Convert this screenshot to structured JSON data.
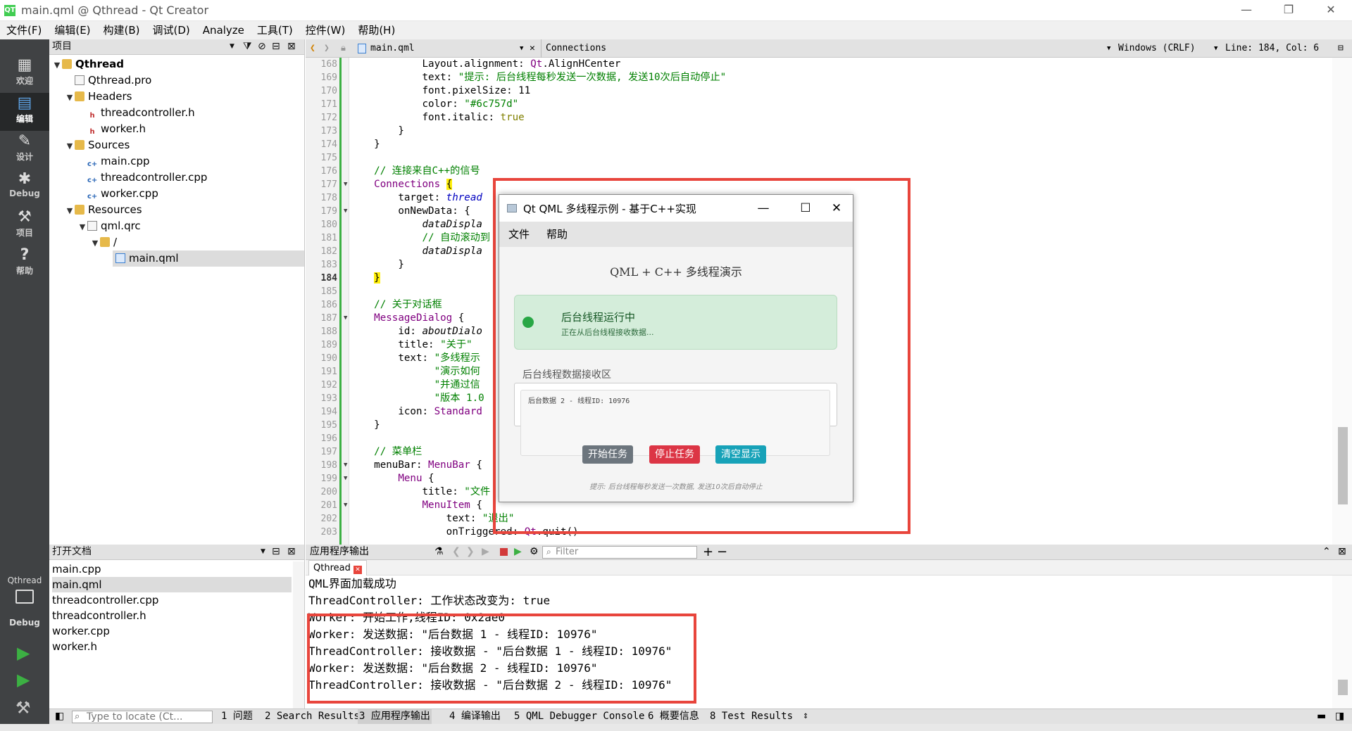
{
  "window": {
    "title": "main.qml @ Qthread - Qt Creator",
    "logo": "QT"
  },
  "menu": [
    "文件(F)",
    "编辑(E)",
    "构建(B)",
    "调试(D)",
    "Analyze",
    "工具(T)",
    "控件(W)",
    "帮助(H)"
  ],
  "modes": [
    {
      "label": "欢迎",
      "icon": "grid-icon"
    },
    {
      "label": "编辑",
      "icon": "document-icon"
    },
    {
      "label": "设计",
      "icon": "pencil-icon"
    },
    {
      "label": "Debug",
      "icon": "bug-icon"
    },
    {
      "label": "项目",
      "icon": "wrench-icon"
    },
    {
      "label": "帮助",
      "icon": "help-icon"
    }
  ],
  "kit": {
    "project": "Qthread",
    "mode": "Debug"
  },
  "project_panel": {
    "title": "项目",
    "tree": [
      {
        "label": "Qthread",
        "bold": true
      },
      {
        "label": "Qthread.pro"
      },
      {
        "label": "Headers"
      },
      {
        "label": "threadcontroller.h"
      },
      {
        "label": "worker.h"
      },
      {
        "label": "Sources"
      },
      {
        "label": "main.cpp"
      },
      {
        "label": "threadcontroller.cpp"
      },
      {
        "label": "worker.cpp"
      },
      {
        "label": "Resources"
      },
      {
        "label": "qml.qrc"
      },
      {
        "label": "/"
      },
      {
        "label": "main.qml",
        "selected": true
      }
    ]
  },
  "open_docs": {
    "title": "打开文档",
    "items": [
      "main.cpp",
      "main.qml",
      "threadcontroller.cpp",
      "threadcontroller.h",
      "worker.cpp",
      "worker.h"
    ]
  },
  "editor": {
    "file": "main.qml",
    "symbol": "Connections",
    "line_ending": "Windows (CRLF)",
    "position": "Line: 184, Col: 6",
    "line_numbers": [
      "168",
      "169",
      "170",
      "171",
      "172",
      "173",
      "174",
      "175",
      "176",
      "177",
      "178",
      "179",
      "180",
      "181",
      "182",
      "183",
      "184",
      "185",
      "186",
      "187",
      "188",
      "189",
      "190",
      "191",
      "192",
      "193",
      "194",
      "195",
      "196",
      "197",
      "198",
      "199",
      "200",
      "201",
      "202",
      "203"
    ],
    "code": [
      "            Layout.alignment: Qt.AlignHCenter",
      "            text: \"提示: 后台线程每秒发送一次数据, 发送10次后自动停止\"",
      "            font.pixelSize: 11",
      "            color: \"#6c757d\"",
      "            font.italic: true",
      "        }",
      "    }",
      "",
      "    // 连接来自C++的信号",
      "    Connections {",
      "        target: thread",
      "        onNewData: {",
      "            dataDispla",
      "            // 自动滚动到",
      "            dataDispla",
      "        }",
      "    }",
      "",
      "    // 关于对话框",
      "    MessageDialog {",
      "        id: aboutDialo",
      "        title: \"关于\"",
      "        text: \"多线程示",
      "              \"演示如何",
      "              \"并通过信",
      "              \"版本 1.0",
      "        icon: Standard",
      "    }",
      "",
      "    // 菜单栏",
      "    menuBar: MenuBar {",
      "        Menu {",
      "            title: \"文件",
      "            MenuItem {",
      "                text: \"退出\"",
      "                onTriggered: Qt.quit()"
    ]
  },
  "app_window": {
    "title": "Qt QML 多线程示例 - 基于C++实现",
    "menu": [
      "文件",
      "帮助"
    ],
    "heading": "QML + C++ 多线程演示",
    "status_title": "后台线程运行中",
    "status_sub": "正在从后台线程接收数据...",
    "receive_label": "后台线程数据接收区",
    "data_line": "后台数据 2 - 线程ID: 10976",
    "buttons": {
      "start": "开始任务",
      "stop": "停止任务",
      "clear": "清空显示"
    },
    "hint": "提示: 后台线程每秒发送一次数据, 发送10次后自动停止",
    "colors": {
      "status_bg": "#d4edda",
      "dot": "#28a745",
      "start": "#6c757d",
      "stop": "#dc3545",
      "clear": "#17a2b8"
    }
  },
  "output": {
    "title": "应用程序输出",
    "filter_placeholder": "Filter",
    "tab": "Qthread",
    "lines": [
      "QML界面加载成功",
      "ThreadController: 工作状态改变为: true",
      "Worker: 开始工作,线程ID: 0x2ae0",
      "Worker: 发送数据: \"后台数据 1 - 线程ID: 10976\"",
      "ThreadController: 接收数据 - \"后台数据 1 - 线程ID: 10976\"",
      "Worker: 发送数据: \"后台数据 2 - 线程ID: 10976\"",
      "ThreadController: 接收数据 - \"后台数据 2 - 线程ID: 10976\""
    ]
  },
  "statusbar": {
    "locator_placeholder": "Type to locate (Ct...",
    "panes": [
      "1 问题",
      "2 Search Results",
      "3 应用程序输出",
      "4 编译输出",
      "5 QML Debugger Console",
      "6 概要信息",
      "8 Test Results"
    ]
  },
  "colors": {
    "annotation_red": "#e8453c",
    "modebar": "#404244"
  }
}
